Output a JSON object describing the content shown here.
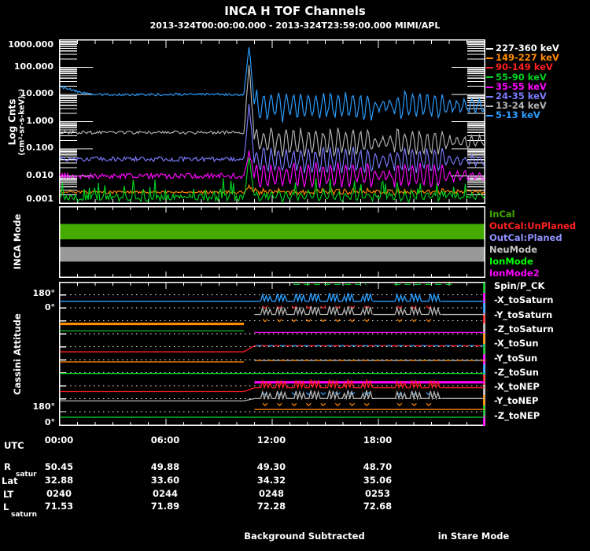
{
  "title": "INCA H TOF Channels",
  "subtitle": "2013-324T00:00:00.000 - 2013-324T23:59:00.000 MIMI/APL",
  "colors": {
    "white": "#FFFFFF",
    "orange": "#FF8A00",
    "red": "#FF2020",
    "green": "#00C020",
    "bright_green": "#00FF00",
    "magenta": "#FF00FF",
    "slate_blue": "#7B7BFF",
    "periwinkle": "#9090FF",
    "gray": "#B4B4B4",
    "light_gray": "#C8C8C8",
    "cyan_blue": "#2B9FFF",
    "mode_green": "#44AA00",
    "mode_gray": "#999999"
  },
  "chart_data": [
    {
      "type": "line",
      "panel": "tof_counts",
      "title": "INCA H TOF Channels",
      "ylabel1": "Log Cnts",
      "ylabel2": "(cm²-sr-s-keV)⁻¹",
      "y_scale": "log",
      "ylim": [
        0.001,
        1000
      ],
      "ytick_labels": [
        "1000.000",
        "100.000",
        "10.000",
        "1.000",
        "0.100",
        "0.010",
        "0.001"
      ],
      "x_unit": "UTC hours of 2013-324",
      "xlim_hours": [
        0,
        24
      ],
      "xtick_labels": [
        "00:00",
        "06:00",
        "12:00",
        "18:00"
      ],
      "event_hour": 10.7,
      "calm_windows_hours": [
        [
          17.7,
          18.9
        ],
        [
          21.7,
          24
        ]
      ],
      "series": [
        {
          "name": "227-360 keV",
          "color": "#FFFFFF",
          "left_log": -3.5,
          "right_log": -3.5,
          "noise": 0.05,
          "osc_amp": 0,
          "spike_log": null
        },
        {
          "name": "149-227 keV",
          "color": "#FF8A00",
          "left_log": -2.6,
          "right_log": -2.58,
          "noise": 0.05,
          "osc_amp": 0.07,
          "spike_log": -2.15
        },
        {
          "name": "90-149 keV",
          "color": "#FF2020",
          "left_log": -3.5,
          "right_log": -3.5,
          "noise": 0.05,
          "osc_amp": 0,
          "spike_log": null
        },
        {
          "name": "55-90 keV",
          "color": "#00D020",
          "left_log": -2.8,
          "right_log": -2.75,
          "noise": 0.14,
          "osc_amp": 0.2,
          "spike_log": -1.15,
          "spiky": true
        },
        {
          "name": "35-55 keV",
          "color": "#FF00FF",
          "left_log": -2.0,
          "right_log": -2.0,
          "noise": 0.1,
          "osc_amp": 0.48,
          "spike_log": -0.9
        },
        {
          "name": "24-35 keV",
          "color": "#7B7BFF",
          "left_log": -1.38,
          "right_log": -1.42,
          "noise": 0.09,
          "osc_amp": 0.52,
          "spike_log": 0.8
        },
        {
          "name": "13-24 keV",
          "color": "#B4B4B4",
          "left_log": -0.4,
          "right_log": -0.75,
          "noise": 0.06,
          "osc_amp": 0.55,
          "spike_log": 2.35
        },
        {
          "name": "5-13 keV",
          "color": "#2B9FFF",
          "left_log": 1.0,
          "right_log": 0.58,
          "noise": 0.05,
          "osc_amp": 0.6,
          "spike_log": 2.92,
          "start_log": 1.3
        }
      ]
    },
    {
      "type": "mode-bars",
      "panel": "inca_mode",
      "label": "INCA Mode",
      "bars": [
        {
          "mode": "InCal",
          "color": "#44AA00",
          "x_hours": [
            0,
            24
          ],
          "f0": 0.242,
          "f1": 0.462
        },
        {
          "mode": "NeuMode",
          "color": "#999999",
          "x_hours": [
            0,
            24
          ],
          "f0": 0.571,
          "f1": 0.78
        }
      ],
      "legend": [
        {
          "label": "InCal",
          "color": "#44AA00"
        },
        {
          "label": "OutCal:UnPlaned",
          "color": "#FF2020"
        },
        {
          "label": "OutCal:Planed",
          "color": "#9090FF"
        },
        {
          "label": "NeuMode",
          "color": "#C8C8C8"
        },
        {
          "label": "IonMode",
          "color": "#00FF00"
        },
        {
          "label": "IonMode2",
          "color": "#FF00FF"
        }
      ]
    },
    {
      "type": "attitude",
      "panel": "cassini_attitude",
      "label": "Cassini Attitude",
      "axis_labels": [
        "180°",
        "0°",
        "180°",
        "0°"
      ],
      "slew_hours": [
        10.4,
        11.0
      ],
      "osc_windows_hours": [
        [
          11.35,
          17.7
        ],
        [
          18.95,
          21.6
        ]
      ],
      "legend": [
        "Spin/P_CK",
        "-X_toSaturn",
        "-Y_toSaturn",
        "-Z_toSaturn",
        "-X_toSun",
        "-Y_toSun",
        "-Z_toSun",
        "-X_toNEP",
        "-Y_toNEP",
        "-Z_toNEP"
      ],
      "axis_tick_cycle": [
        "#00C020",
        "#FF00FF",
        "#2B9FFF",
        "#FF2020",
        "#B4B4B4",
        "#FF8A00"
      ],
      "lines": [
        {
          "trace": "Spin/P_CK",
          "color": "#00C020",
          "w": 1.3,
          "left": null,
          "right": 0.013,
          "segs": [
            [
              13.2,
              17.3
            ],
            [
              18.9,
              22.2
            ]
          ]
        },
        {
          "trace": "-X_toSaturn",
          "color": "#2B9FFF",
          "w": 1.3,
          "left": 0.131,
          "right": 0.131,
          "osc": true,
          "mark": "#FF2020"
        },
        {
          "trace": "-Y_toSaturn",
          "color": "#B4B4B4",
          "w": 1.3,
          "left": null,
          "right": 0.224,
          "osc": true,
          "mark": "#FF8A00"
        },
        {
          "trace": "-Z_toSaturn",
          "color": "#FF8A00",
          "w": 3.2,
          "left": 0.29,
          "right": null
        },
        {
          "trace": "-Z_toSaturn",
          "color": "#FF00FF",
          "w": 1.3,
          "left": null,
          "right": 0.35
        },
        {
          "trace": "-X_toSun",
          "color": "#00C020",
          "w": 1.3,
          "left": 0.339,
          "right": null
        },
        {
          "trace": "-Y_toSun",
          "color": "#FF2020",
          "w": 1.3,
          "left": 0.486,
          "right": 0.443,
          "overlay": "#2B9FFF"
        },
        {
          "trace": "-Z_toSun",
          "color": "#FF8A00",
          "w": 1.3,
          "left": 0.557,
          "right": null
        },
        {
          "trace": "-Z_toSun",
          "color": "#B4B4B4",
          "w": 1.3,
          "left": null,
          "right": 0.546,
          "overlay": "#FF8A00"
        },
        {
          "trace": "-X_toNEP",
          "color": "#00C020",
          "w": 1.3,
          "left": 0.639,
          "right": 0.639
        },
        {
          "trace": "-Y_toNEP",
          "color": "#FF00FF",
          "w": 3.2,
          "left": null,
          "right": 0.7
        },
        {
          "trace": "-Z_toNEP",
          "color": "#FF2020",
          "w": 1.3,
          "left": 0.765,
          "right": 0.738,
          "osc": true,
          "mark": "#2B9FFF"
        },
        {
          "trace": "-Y_toNEP",
          "color": "#B4B4B4",
          "w": 1.3,
          "left": 0.83,
          "right": 0.814,
          "osc": true,
          "mark": "#FF8A00"
        },
        {
          "trace": "-Z_toNEP",
          "color": "#FF8A00",
          "w": 1.3,
          "left": null,
          "right": 0.89
        },
        {
          "trace": "-Z_toNEP",
          "color": "#00C020",
          "w": 1.3,
          "left": 0.945,
          "right": 0.945
        }
      ]
    }
  ],
  "utc": {
    "label": "UTC",
    "ticks": [
      "00:00",
      "06:00",
      "12:00",
      "18:00"
    ]
  },
  "table": {
    "rows": [
      {
        "label": "R",
        "sub": "satur",
        "values": [
          "50.45",
          "49.88",
          "49.30",
          "48.70"
        ]
      },
      {
        "label": "Lat",
        "sub": "",
        "values": [
          "32.88",
          "33.60",
          "34.32",
          "35.06"
        ]
      },
      {
        "label": "LT",
        "sub": "",
        "values": [
          "0240",
          "0244",
          "0248",
          "0253"
        ]
      },
      {
        "label": "L",
        "sub": "saturn",
        "values": [
          "71.53",
          "71.89",
          "72.28",
          "72.68"
        ]
      }
    ]
  },
  "footer": {
    "center": "Background Subtracted",
    "right": "in Stare Mode"
  }
}
